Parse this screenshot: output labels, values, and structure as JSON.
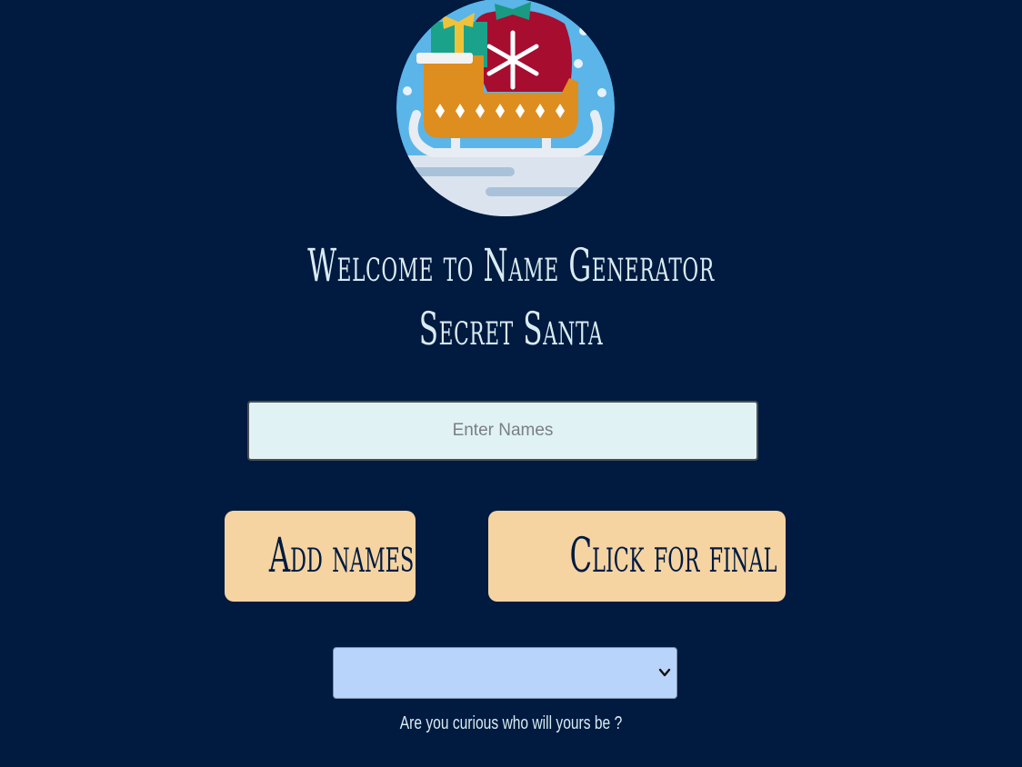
{
  "header": {
    "title_line1": "Welcome to Name Generator",
    "title_line2": "Secret Santa"
  },
  "logo": {
    "icon": "santa-sleigh-icon"
  },
  "form": {
    "names_placeholder": "Enter Names",
    "add_button_label": "Add names",
    "final_list_button_label": "Click for final list",
    "select_value": "",
    "caption": "Are you curious who will yours be ?"
  },
  "colors": {
    "background": "#001a40",
    "title_text": "#d9ecf2",
    "input_bg": "#e1f2f5",
    "button_bg": "#f5d4a2",
    "button_text": "#001a40",
    "select_bg": "#b8d4fa"
  }
}
